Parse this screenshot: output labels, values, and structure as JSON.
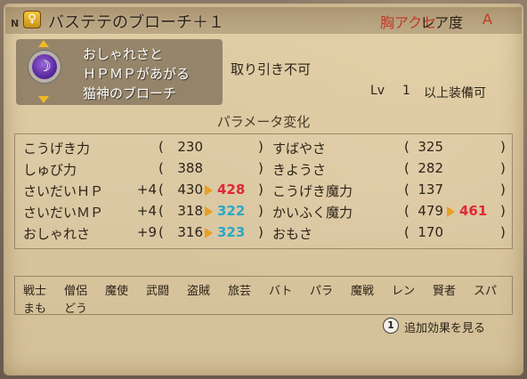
{
  "header": {
    "corner_letter": "N",
    "item_icon": "ring-icon",
    "item_icon_glyph": "♀",
    "title": "バステテのブローチ＋１",
    "category": "胸アクセ",
    "rarity_label": "レア度",
    "rarity_value": "A"
  },
  "item": {
    "emblem_icon": "cat-god-brooch-emblem",
    "emblem_glyph": "☽",
    "description": [
      "おしゃれさと",
      "ＨＰＭＰがあがる",
      "猫神のブローチ"
    ],
    "trade": "取り引き不可",
    "lv_label": "Lv",
    "lv_value": "1",
    "lv_text": "以上装備可"
  },
  "section_title": "パラメータ変化",
  "stats": {
    "left": [
      {
        "name": "こうげき力",
        "bonus": "",
        "current": "230",
        "new": "",
        "new_color": ""
      },
      {
        "name": "しゅび力",
        "bonus": "",
        "current": "388",
        "new": "",
        "new_color": ""
      },
      {
        "name": "さいだいＨＰ",
        "bonus": "+4",
        "current": "430",
        "new": "428",
        "new_color": "#e0283a"
      },
      {
        "name": "さいだいＭＰ",
        "bonus": "+4",
        "current": "318",
        "new": "322",
        "new_color": "#28a8c8"
      },
      {
        "name": "おしゃれさ",
        "bonus": "+9",
        "current": "316",
        "new": "323",
        "new_color": "#28a8c8"
      }
    ],
    "right": [
      {
        "name": "すばやさ",
        "bonus": "",
        "current": "325",
        "new": "",
        "new_color": ""
      },
      {
        "name": "きようさ",
        "bonus": "",
        "current": "282",
        "new": "",
        "new_color": ""
      },
      {
        "name": "こうげき魔力",
        "bonus": "",
        "current": "137",
        "new": "",
        "new_color": ""
      },
      {
        "name": "かいふく魔力",
        "bonus": "",
        "current": "479",
        "new": "461",
        "new_color": "#e0283a"
      },
      {
        "name": "おもさ",
        "bonus": "",
        "current": "170",
        "new": "",
        "new_color": ""
      }
    ],
    "lparen": "(",
    "rparen": ")"
  },
  "jobs": {
    "row1": [
      "戦士",
      "僧侶",
      "魔使",
      "武闘",
      "盗賊",
      "旅芸",
      "バト",
      "パラ",
      "魔戦",
      "レン",
      "賢者",
      "スパ"
    ],
    "row2": [
      "まも",
      "どう"
    ]
  },
  "footer": {
    "button_icon": "circle-1-button-icon",
    "button_glyph": "1",
    "label": "追加効果を見る"
  }
}
